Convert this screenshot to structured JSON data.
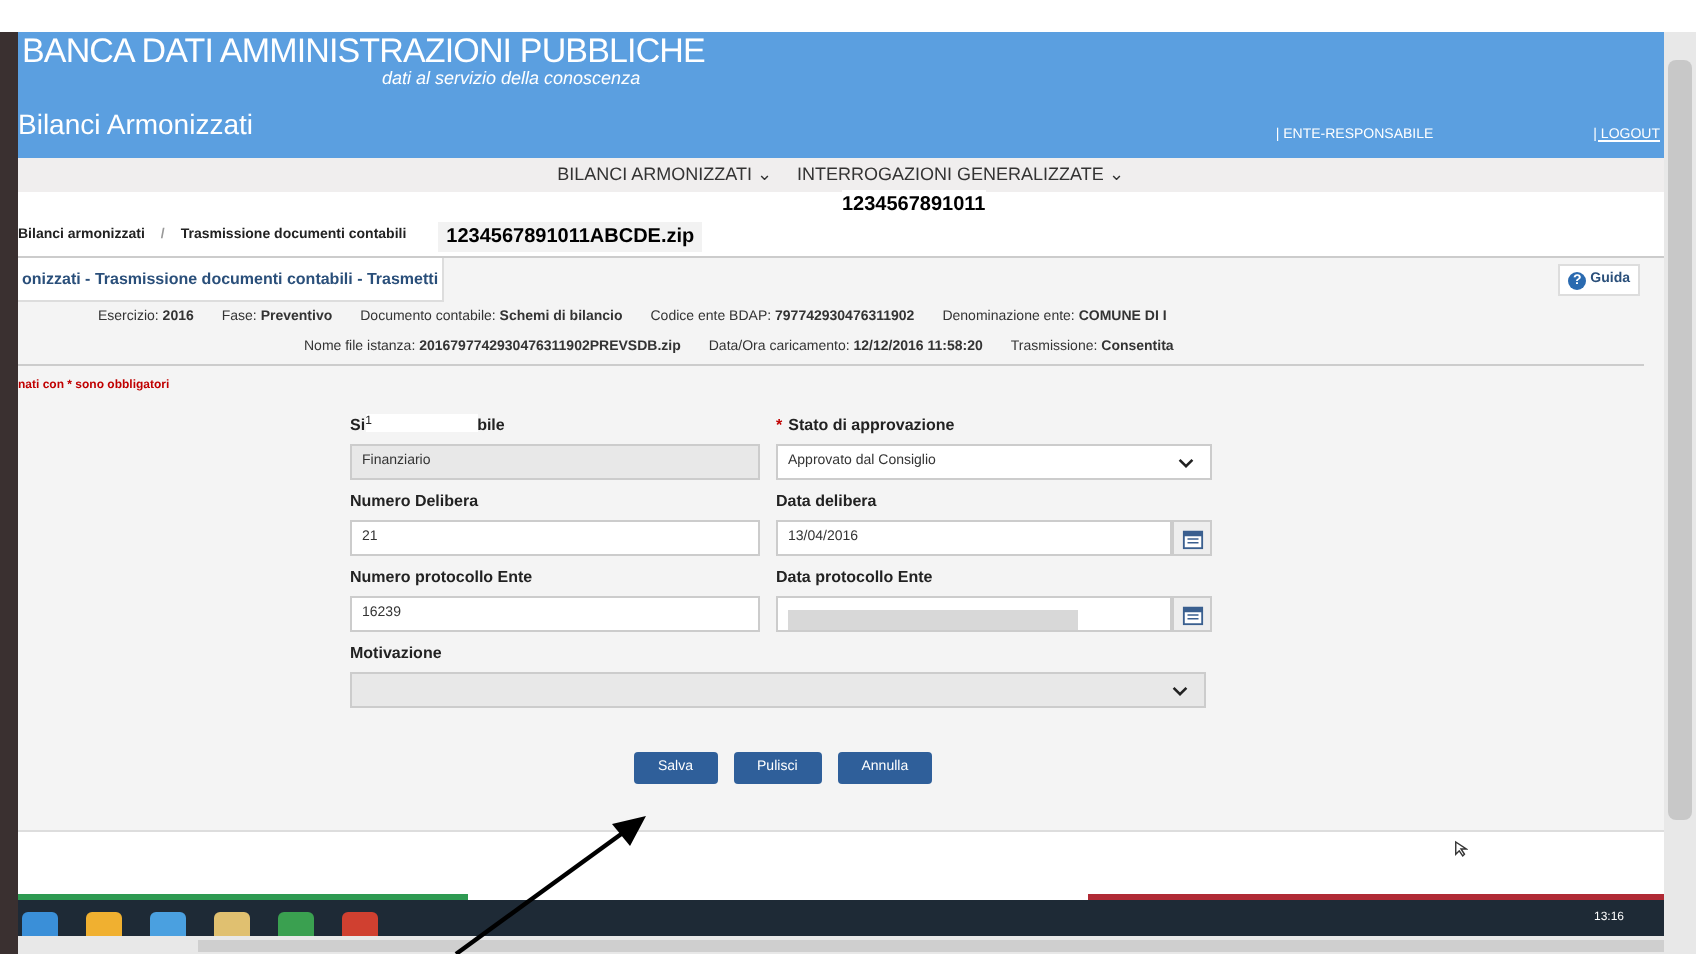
{
  "header": {
    "title": "BANCA DATI AMMINISTRAZIONI PUBBLICHE",
    "subtitle": "dati al servizio della conoscenza",
    "app_name": "Bilanci Armonizzati",
    "user_links": [
      {
        "label": "| ENTE-RESPONSABILE",
        "kind": "text"
      },
      {
        "label": "| LOGOUT",
        "kind": "link"
      }
    ]
  },
  "nav": [
    {
      "label": "BILANCI ARMONIZZATI ⌄"
    },
    {
      "label": "INTERROGAZIONI GENERALIZZATE ⌄"
    }
  ],
  "overlay_code": "1234567891011",
  "breadcrumb": [
    {
      "label": "Bilanci armonizzati"
    },
    {
      "label": "Trasmissione documenti contabili"
    }
  ],
  "breadcrumb_separator": "/",
  "overlay_file": "1234567891011ABCDE.zip",
  "page_tab": {
    "label": "onizzati - Trasmissione documenti contabili - Trasmetti",
    "help_icon": "?",
    "help": "Guida"
  },
  "info_rows": [
    [
      {
        "label": "Esercizio:",
        "value": "2016"
      },
      {
        "label": "Fase:",
        "value": "Preventivo"
      },
      {
        "label": "Documento contabile:",
        "value": "Schemi di bilancio"
      },
      {
        "label": "Codice ente BDAP:",
        "value": "797742930476311902"
      },
      {
        "label": "Denominazione ente:",
        "value": "COMUNE DI I"
      }
    ],
    [
      {
        "label": "Nome file istanza:",
        "value": "2016797742930476311902PREVSDB.zip"
      },
      {
        "label": "Data/Ora caricamento:",
        "value": "12/12/2016 11:58:20"
      },
      {
        "label": "Trasmissione:",
        "value": "Consentita"
      }
    ]
  ],
  "required_note": "nati con * sono obbligatori",
  "fields": [
    {
      "label_parts": [
        "Si",
        "1",
        "bile"
      ],
      "kind": "readonly",
      "value": "Finanziario"
    },
    {
      "label": "Stato di approvazione",
      "required_mark": "*",
      "kind": "select",
      "value": "Approvato dal Consiglio"
    },
    {
      "label": "Numero Delibera",
      "kind": "text",
      "value": "21"
    },
    {
      "label": "Data delibera",
      "kind": "date",
      "value": "13/04/2016"
    },
    {
      "label": "Numero protocollo Ente",
      "kind": "text",
      "value": "16239"
    },
    {
      "label": "Data protocollo Ente",
      "kind": "date",
      "redacted": true
    },
    {
      "label": "Motivazione",
      "kind": "select_wide",
      "disabled": true
    }
  ],
  "buttons": [
    {
      "label": "Salva"
    },
    {
      "label": "Pulisci"
    },
    {
      "label": "Annulla"
    }
  ],
  "taskbar": {
    "clock": "13:16"
  }
}
